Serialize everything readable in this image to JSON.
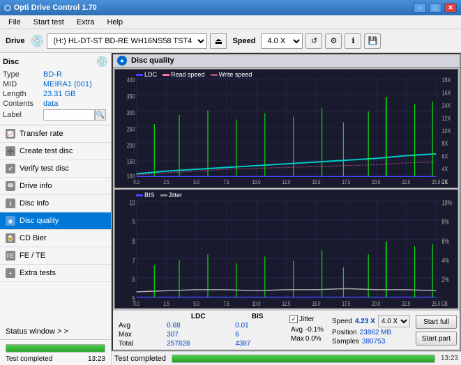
{
  "app": {
    "title": "Opti Drive Control 1.70",
    "title_icon": "●"
  },
  "titlebar": {
    "minimize": "─",
    "maximize": "□",
    "close": "✕"
  },
  "menu": {
    "items": [
      "File",
      "Start test",
      "Extra",
      "Help"
    ]
  },
  "toolbar": {
    "drive_label": "Drive",
    "drive_icon": "💿",
    "drive_value": "(H:)  HL-DT-ST BD-RE  WH16NS58 TST4",
    "eject_icon": "⏏",
    "speed_label": "Speed",
    "speed_value": "4.0 X"
  },
  "disc": {
    "header": "Disc",
    "type_label": "Type",
    "type_value": "BD-R",
    "mid_label": "MID",
    "mid_value": "MEIRA1 (001)",
    "length_label": "Length",
    "length_value": "23.31 GB",
    "contents_label": "Contents",
    "contents_value": "data",
    "label_label": "Label",
    "label_value": ""
  },
  "nav": {
    "items": [
      {
        "id": "transfer-rate",
        "label": "Transfer rate",
        "active": false
      },
      {
        "id": "create-test-disc",
        "label": "Create test disc",
        "active": false
      },
      {
        "id": "verify-test-disc",
        "label": "Verify test disc",
        "active": false
      },
      {
        "id": "drive-info",
        "label": "Drive info",
        "active": false
      },
      {
        "id": "disc-info",
        "label": "Disc info",
        "active": false
      },
      {
        "id": "disc-quality",
        "label": "Disc quality",
        "active": true
      },
      {
        "id": "cd-bier",
        "label": "CD Bier",
        "active": false
      },
      {
        "id": "fe-te",
        "label": "FE / TE",
        "active": false
      },
      {
        "id": "extra-tests",
        "label": "Extra tests",
        "active": false
      }
    ]
  },
  "status_window": {
    "label": "Status window > >"
  },
  "disc_quality": {
    "panel_title": "Disc quality",
    "chart1": {
      "legend": [
        {
          "label": "LDC",
          "color": "#0000ff"
        },
        {
          "label": "Read speed",
          "color": "#ff69b4"
        },
        {
          "label": "Write speed",
          "color": "#ff69b4"
        }
      ],
      "y_max": 400,
      "y_axis_right": [
        "18X",
        "16X",
        "14X",
        "12X",
        "10X",
        "8X",
        "6X",
        "4X",
        "2X"
      ],
      "x_axis": [
        "0.0",
        "2.5",
        "5.0",
        "7.5",
        "10.0",
        "12.5",
        "15.0",
        "17.5",
        "20.0",
        "22.5",
        "25.0 GB"
      ]
    },
    "chart2": {
      "legend": [
        {
          "label": "BIS",
          "color": "#0000ff"
        },
        {
          "label": "Jitter",
          "color": "#888"
        }
      ],
      "y_max": 10,
      "y_axis_right": [
        "10%",
        "8%",
        "6%",
        "4%",
        "2%"
      ],
      "x_axis": [
        "0.0",
        "2.5",
        "5.0",
        "7.5",
        "10.0",
        "12.5",
        "15.0",
        "17.5",
        "20.0",
        "22.5",
        "25.0 GB"
      ]
    }
  },
  "stats": {
    "headers": [
      "LDC",
      "BIS",
      "",
      "Jitter",
      "Speed",
      ""
    ],
    "avg_label": "Avg",
    "avg_ldc": "0.68",
    "avg_bis": "0.01",
    "avg_jitter": "-0.1%",
    "avg_speed": "4.23 X",
    "avg_speed_select": "4.0 X",
    "max_label": "Max",
    "max_ldc": "307",
    "max_bis": "6",
    "max_jitter": "0.0%",
    "max_position_label": "Position",
    "max_position_value": "23862 MB",
    "total_label": "Total",
    "total_ldc": "257828",
    "total_bis": "4387",
    "total_samples_label": "Samples",
    "total_samples_value": "380753",
    "jitter_checked": true,
    "jitter_label": "Jitter",
    "start_full_label": "Start full",
    "start_part_label": "Start part"
  },
  "app_status": {
    "text": "Test completed",
    "progress": 100,
    "time": "13:23"
  },
  "colors": {
    "accent_blue": "#0078d7",
    "chart_bg": "#1a1a2e",
    "chart_grid": "#2a2a5a",
    "ldc_color": "#4444ff",
    "bis_color": "#3399ff",
    "speed_color": "#00cccc",
    "spike_color": "#00ff00",
    "jitter_line": "#aaaaaa"
  }
}
